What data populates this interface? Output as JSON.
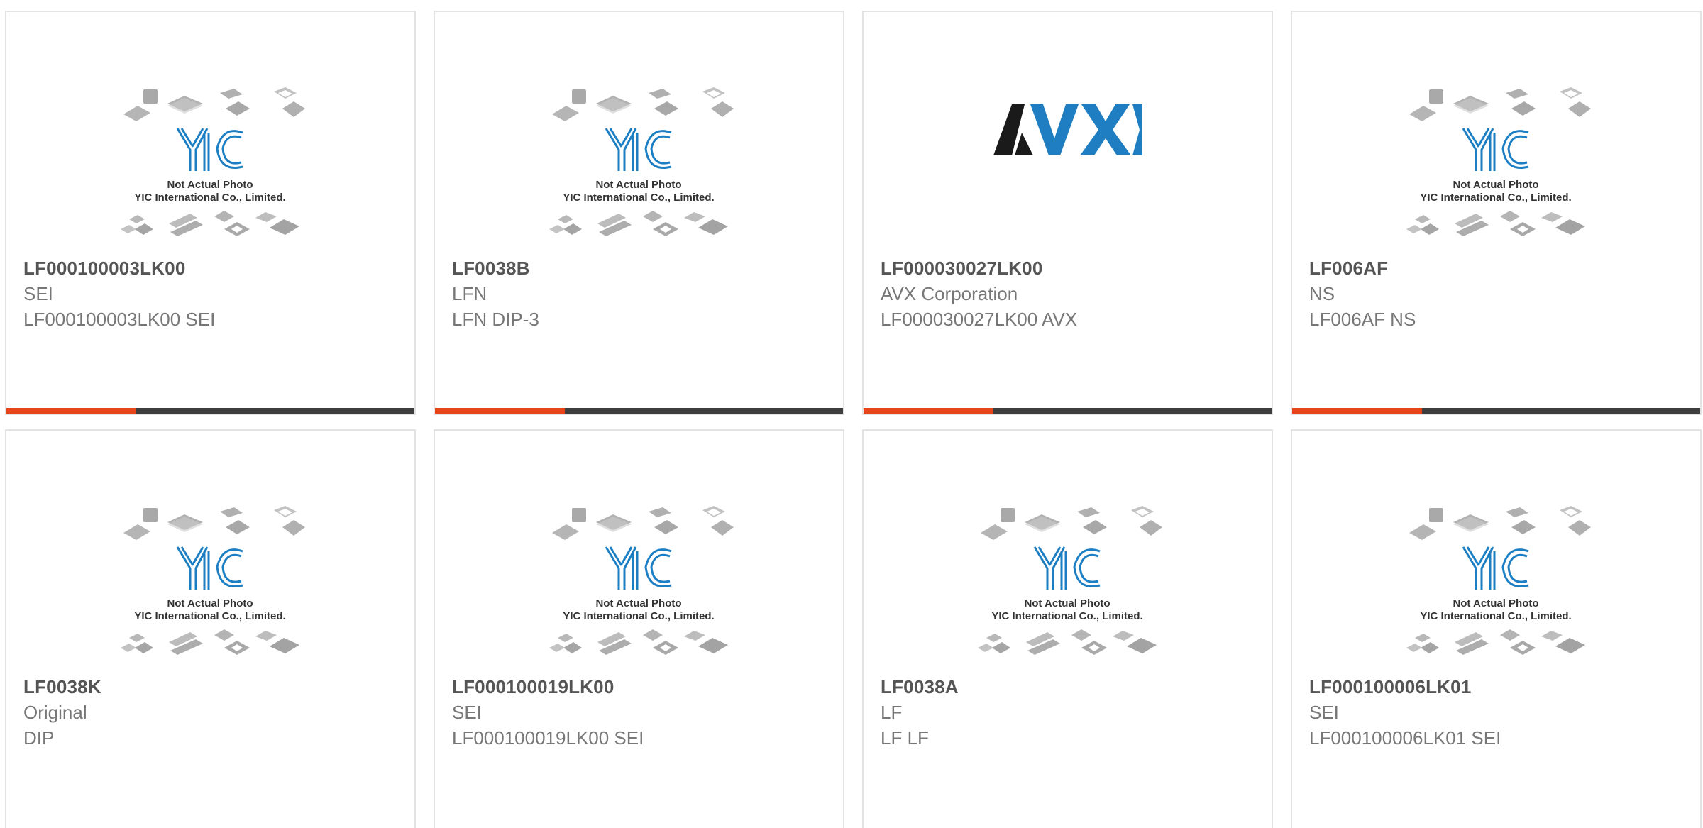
{
  "colors": {
    "accent": "#e8441a",
    "bar": "#3d3d3d",
    "yic_blue": "#1c7fc4",
    "avx_blue": "#1f7ec1"
  },
  "placeholder": {
    "line1": "Not Actual Photo",
    "line2": "YIC International Co., Limited.",
    "logo": "YIC"
  },
  "avx_logo": "AVX",
  "products": [
    {
      "part": "LF000100003LK00",
      "mfr": "SEI",
      "desc": "LF000100003LK00 SEI",
      "image": "yic-placeholder"
    },
    {
      "part": "LF0038B",
      "mfr": "LFN",
      "desc": "LFN DIP-3",
      "image": "yic-placeholder"
    },
    {
      "part": "LF000030027LK00",
      "mfr": "AVX Corporation",
      "desc": "LF000030027LK00 AVX",
      "image": "avx-logo"
    },
    {
      "part": "LF006AF",
      "mfr": "NS",
      "desc": "LF006AF NS",
      "image": "yic-placeholder"
    },
    {
      "part": "LF0038K",
      "mfr": "Original",
      "desc": "DIP",
      "image": "yic-placeholder"
    },
    {
      "part": "LF000100019LK00",
      "mfr": "SEI",
      "desc": "LF000100019LK00 SEI",
      "image": "yic-placeholder"
    },
    {
      "part": "LF0038A",
      "mfr": "LF",
      "desc": "LF LF",
      "image": "yic-placeholder"
    },
    {
      "part": "LF000100006LK01",
      "mfr": "SEI",
      "desc": "LF000100006LK01 SEI",
      "image": "yic-placeholder"
    }
  ]
}
